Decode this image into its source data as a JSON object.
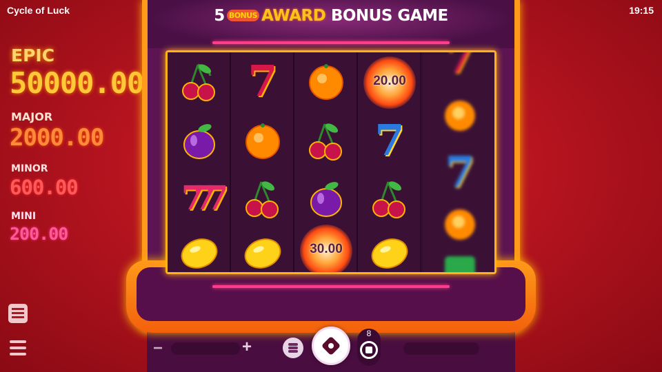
{
  "app": {
    "title": "Cycle of Luck",
    "clock": "19:15"
  },
  "jackpots": [
    {
      "label": "EPIC",
      "value": "50000.00",
      "color": "#ffc83a"
    },
    {
      "label": "MAJOR",
      "value": "2000.00",
      "color": "#ff8a3a"
    },
    {
      "label": "MINOR",
      "value": "600.00",
      "color": "#ff5a5a"
    },
    {
      "label": "MINI",
      "value": "200.00",
      "color": "#ff5a9a"
    }
  ],
  "banner": {
    "count": "5",
    "bonus_badge": "BONUS",
    "award": "AWARD",
    "rest": "BONUS GAME"
  },
  "reels": [
    [
      "cherry",
      "plum",
      "triple-seven",
      "lemon"
    ],
    [
      "red-seven",
      "orange",
      "cherry",
      "lemon"
    ],
    [
      "orange",
      "cherry",
      "plum",
      "fireball"
    ],
    [
      "fireball",
      "blue-seven",
      "cherry",
      "lemon"
    ],
    [
      "red-seven",
      "orange",
      "blue-seven",
      "orange"
    ]
  ],
  "fireball_values": {
    "reel4": "20.00",
    "reel3": "30.00"
  },
  "controls": {
    "minus": "−",
    "plus": "+",
    "autoplay_count": "8"
  },
  "colors": {
    "background": "#b6141f",
    "cabinet_frame": "#ff9a1a",
    "reel_bg": "#3a1135",
    "accent_line": "#ff3d8a"
  }
}
